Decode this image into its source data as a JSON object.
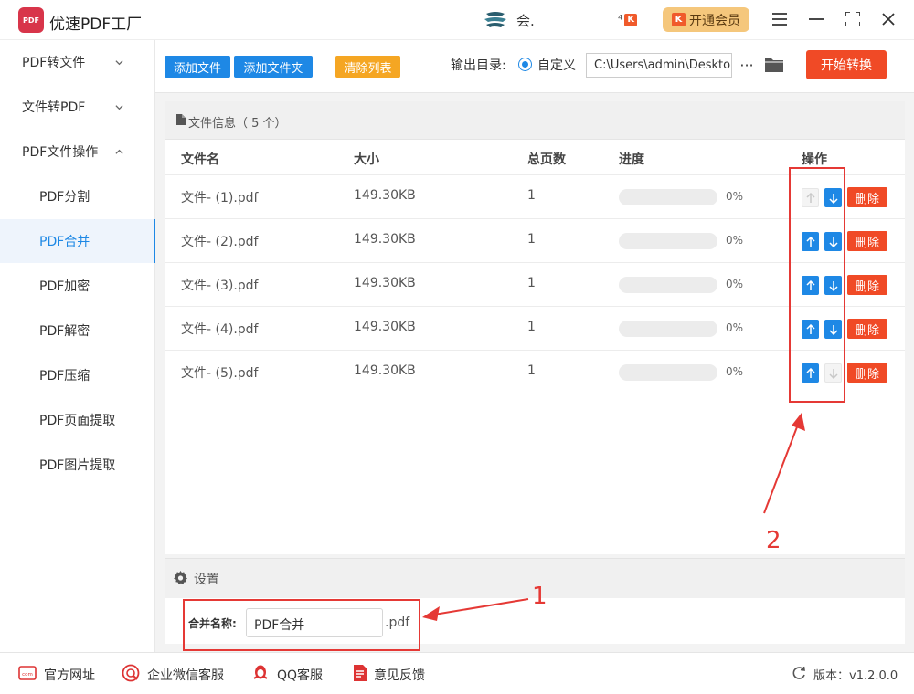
{
  "app": {
    "title": "优速PDF工厂",
    "logo_text": "PDF",
    "user_name": "会.",
    "k_badge": "K",
    "vip_label": "开通会员"
  },
  "sidebar": {
    "items": [
      {
        "label": "PDF转文件"
      },
      {
        "label": "文件转PDF"
      },
      {
        "label": "PDF文件操作"
      },
      {
        "label": "PDF分割"
      },
      {
        "label": "PDF合并"
      },
      {
        "label": "PDF加密"
      },
      {
        "label": "PDF解密"
      },
      {
        "label": "PDF压缩"
      },
      {
        "label": "PDF页面提取"
      },
      {
        "label": "PDF图片提取"
      }
    ],
    "active": "PDF合并"
  },
  "toolbar": {
    "add_file": "添加文件",
    "add_folder": "添加文件夹",
    "clear_list": "清除列表",
    "output_label": "输出目录:",
    "output_option": "自定义",
    "output_path": "C:\\Users\\admin\\Deskto",
    "more": "···",
    "start": "开始转换"
  },
  "file_list": {
    "info": "文件信息（ 5 个）",
    "columns": {
      "name": "文件名",
      "size": "大小",
      "pages": "总页数",
      "progress": "进度",
      "actions": "操作"
    },
    "rows": [
      {
        "name": "文件- (1).pdf",
        "size": "149.30KB",
        "pages": "1",
        "progress": "0%",
        "progress_value": 0
      },
      {
        "name": "文件- (2).pdf",
        "size": "149.30KB",
        "pages": "1",
        "progress": "0%",
        "progress_value": 0
      },
      {
        "name": "文件- (3).pdf",
        "size": "149.30KB",
        "pages": "1",
        "progress": "0%",
        "progress_value": 0
      },
      {
        "name": "文件- (4).pdf",
        "size": "149.30KB",
        "pages": "1",
        "progress": "0%",
        "progress_value": 0
      },
      {
        "name": "文件- (5).pdf",
        "size": "149.30KB",
        "pages": "1",
        "progress": "0%",
        "progress_value": 0
      }
    ],
    "delete_label": "删除"
  },
  "settings": {
    "title": "设置",
    "merge_label": "合并名称:",
    "merge_value": "PDF合并",
    "suffix": ".pdf"
  },
  "footer": {
    "website": "官方网址",
    "wechat": "企业微信客服",
    "qq": "QQ客服",
    "feedback": "意见反馈",
    "version": "版本：v1.2.0.0"
  },
  "annotations": {
    "one": "1",
    "two": "2"
  },
  "colors": {
    "accent": "#1e88e5",
    "danger": "#f04a26",
    "clear": "#f5a623",
    "vip": "#f5c77c",
    "annotation": "#e53935"
  }
}
